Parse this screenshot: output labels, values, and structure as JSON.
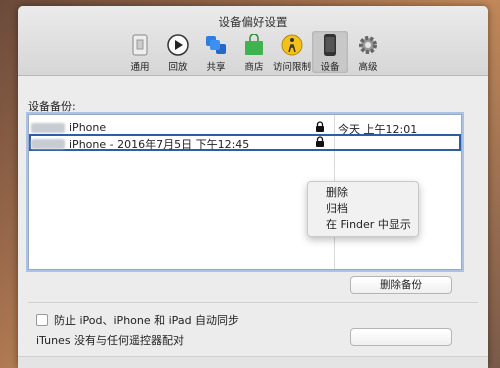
{
  "window": {
    "title": "设备偏好设置"
  },
  "toolbar": {
    "items": [
      {
        "label": "通用",
        "icon": "general-icon"
      },
      {
        "label": "回放",
        "icon": "playback-icon"
      },
      {
        "label": "共享",
        "icon": "sharing-icon"
      },
      {
        "label": "商店",
        "icon": "store-icon"
      },
      {
        "label": "访问限制",
        "icon": "restrictions-icon"
      },
      {
        "label": "设备",
        "icon": "devices-icon",
        "selected": true
      },
      {
        "label": "高级",
        "icon": "advanced-icon"
      }
    ]
  },
  "backups": {
    "section_label": "设备备份:",
    "rows": [
      {
        "name": "iPhone",
        "date": "今天 上午12:01",
        "locked": true
      },
      {
        "name": "iPhone - 2016年7月5日 下午12:45",
        "date": "",
        "locked": true,
        "selected": true
      }
    ],
    "delete_button": "删除备份"
  },
  "context_menu": {
    "items": [
      "删除",
      "归档",
      "在 Finder 中显示"
    ]
  },
  "sync": {
    "checkbox_label": "防止 iPod、iPhone 和 iPad 自动同步",
    "checked": false
  },
  "remote": {
    "text": "iTunes 没有与任何遥控器配对"
  }
}
